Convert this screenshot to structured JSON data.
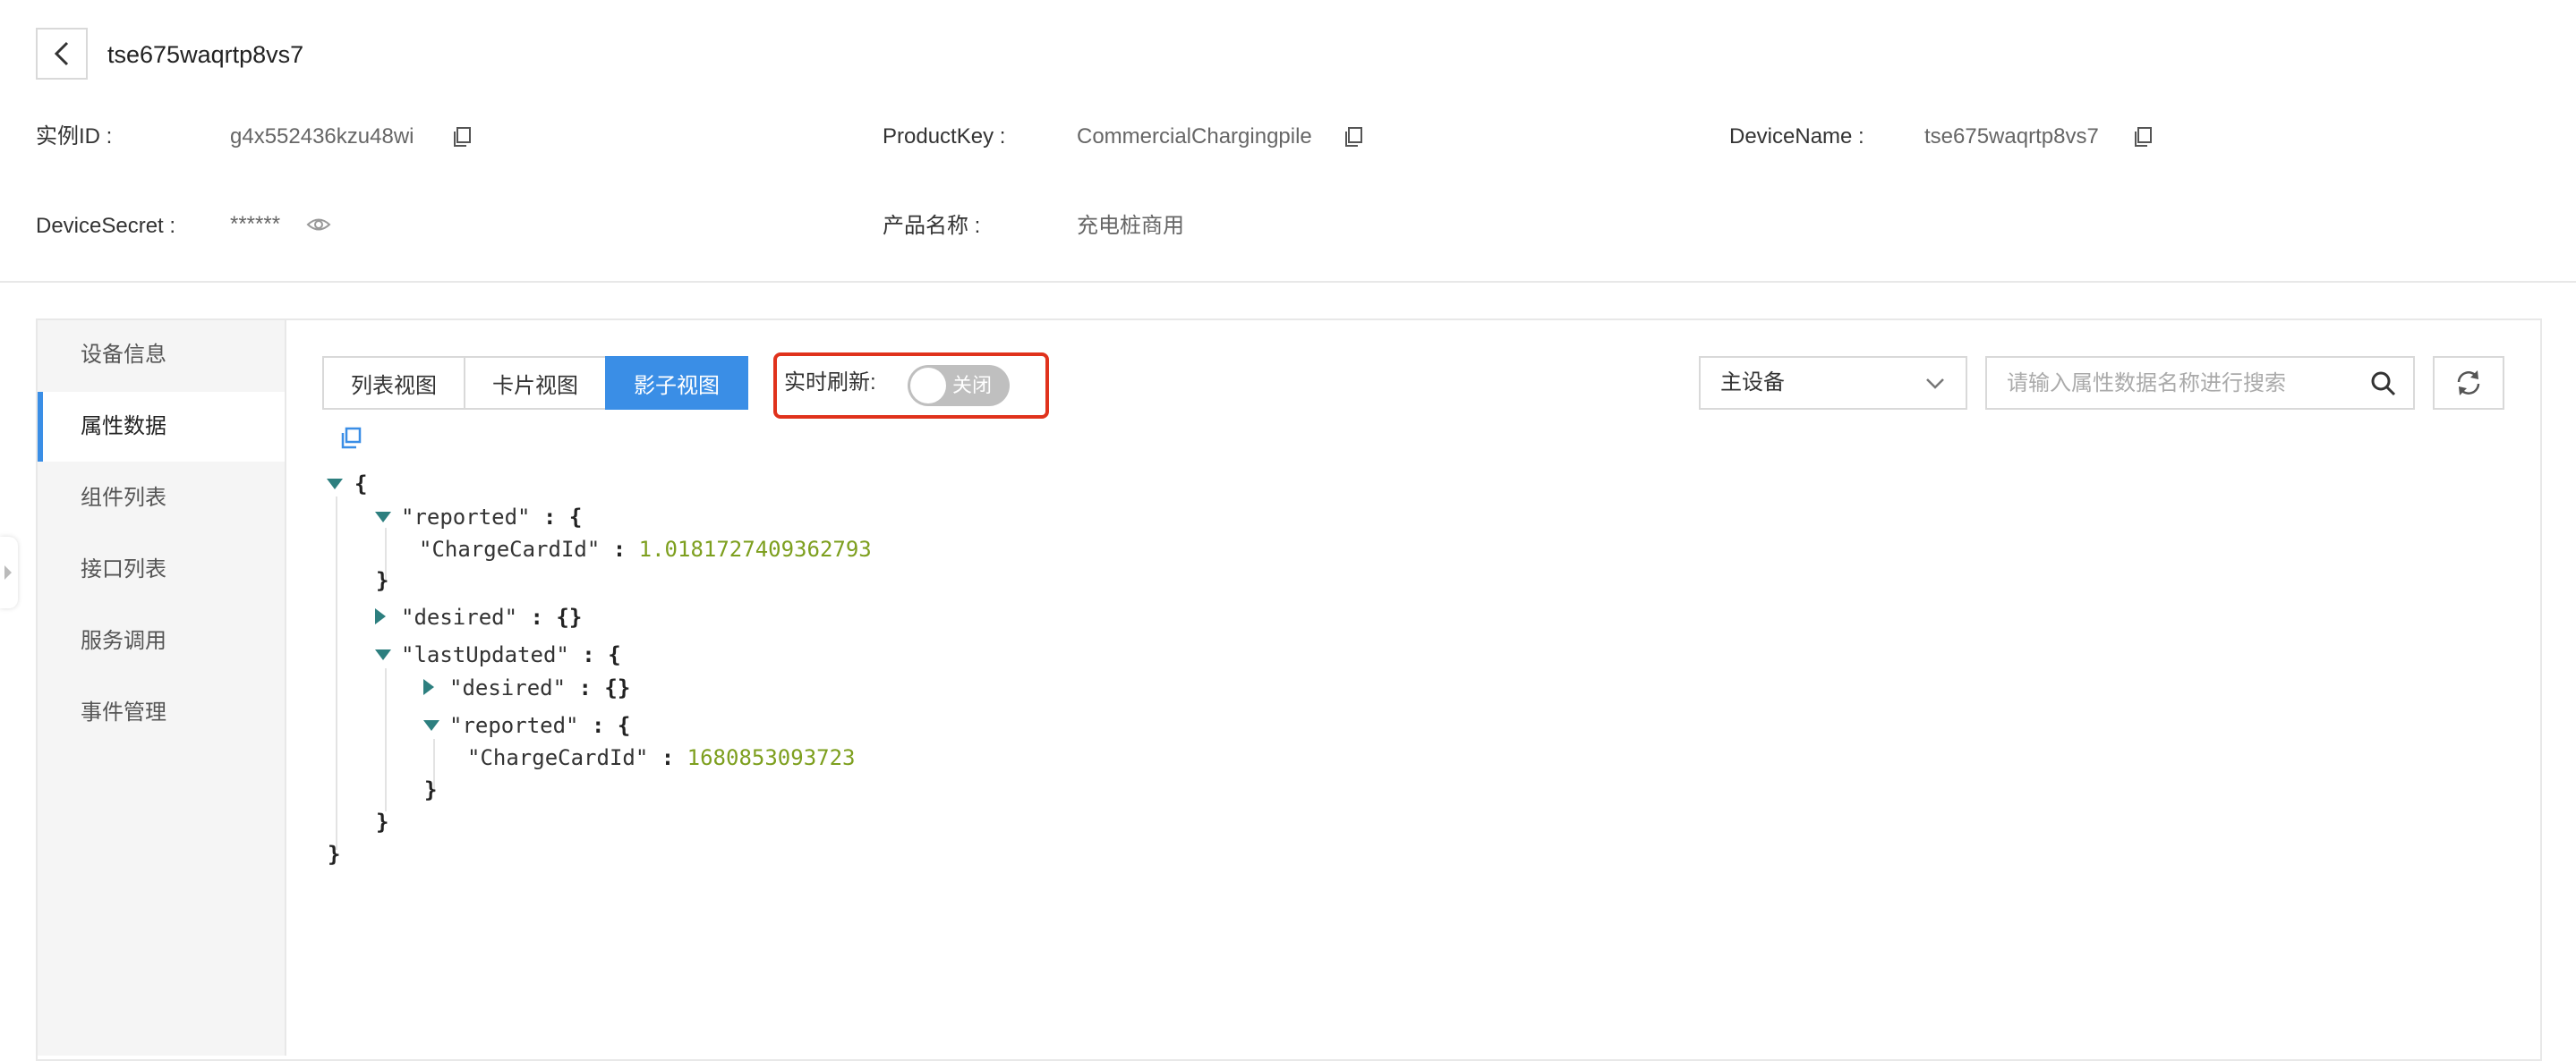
{
  "header": {
    "title": "tse675waqrtp8vs7"
  },
  "info": {
    "instance_id_label": "实例ID :",
    "instance_id_value": "g4x552436kzu48wi",
    "product_key_label": "ProductKey :",
    "product_key_value": "CommercialChargingpile",
    "device_name_label": "DeviceName :",
    "device_name_value": "tse675waqrtp8vs7",
    "device_secret_label": "DeviceSecret :",
    "device_secret_value": "******",
    "product_name_label": "产品名称 :",
    "product_name_value": "充电桩商用"
  },
  "sidebar": {
    "items": [
      {
        "label": "设备信息"
      },
      {
        "label": "属性数据"
      },
      {
        "label": "组件列表"
      },
      {
        "label": "接口列表"
      },
      {
        "label": "服务调用"
      },
      {
        "label": "事件管理"
      }
    ],
    "active_index": 1
  },
  "toolbar": {
    "view_tabs": [
      {
        "label": "列表视图"
      },
      {
        "label": "卡片视图"
      },
      {
        "label": "影子视图"
      }
    ],
    "active_tab_index": 2,
    "realtime_label": "实时刷新:",
    "realtime_toggle_text": "关闭",
    "device_select_value": "主设备",
    "search_placeholder": "请输入属性数据名称进行搜索"
  },
  "shadow_json": {
    "open_brace": "{",
    "close_brace": "}",
    "reported_key": "\"reported\"",
    "charge_card_key": "\"ChargeCardId\"",
    "reported_charge_value": "1.0181727409362793",
    "desired_key": "\"desired\"",
    "empty_obj": "{}",
    "last_updated_key": "\"lastUpdated\"",
    "last_updated_charge_value": "1680853093723",
    "colon": ":"
  },
  "colors": {
    "accent": "#3a8ee6",
    "highlight_border": "#e0321c",
    "json_number": "#7d9f1e",
    "tree_toggle": "#2d7f7f"
  }
}
